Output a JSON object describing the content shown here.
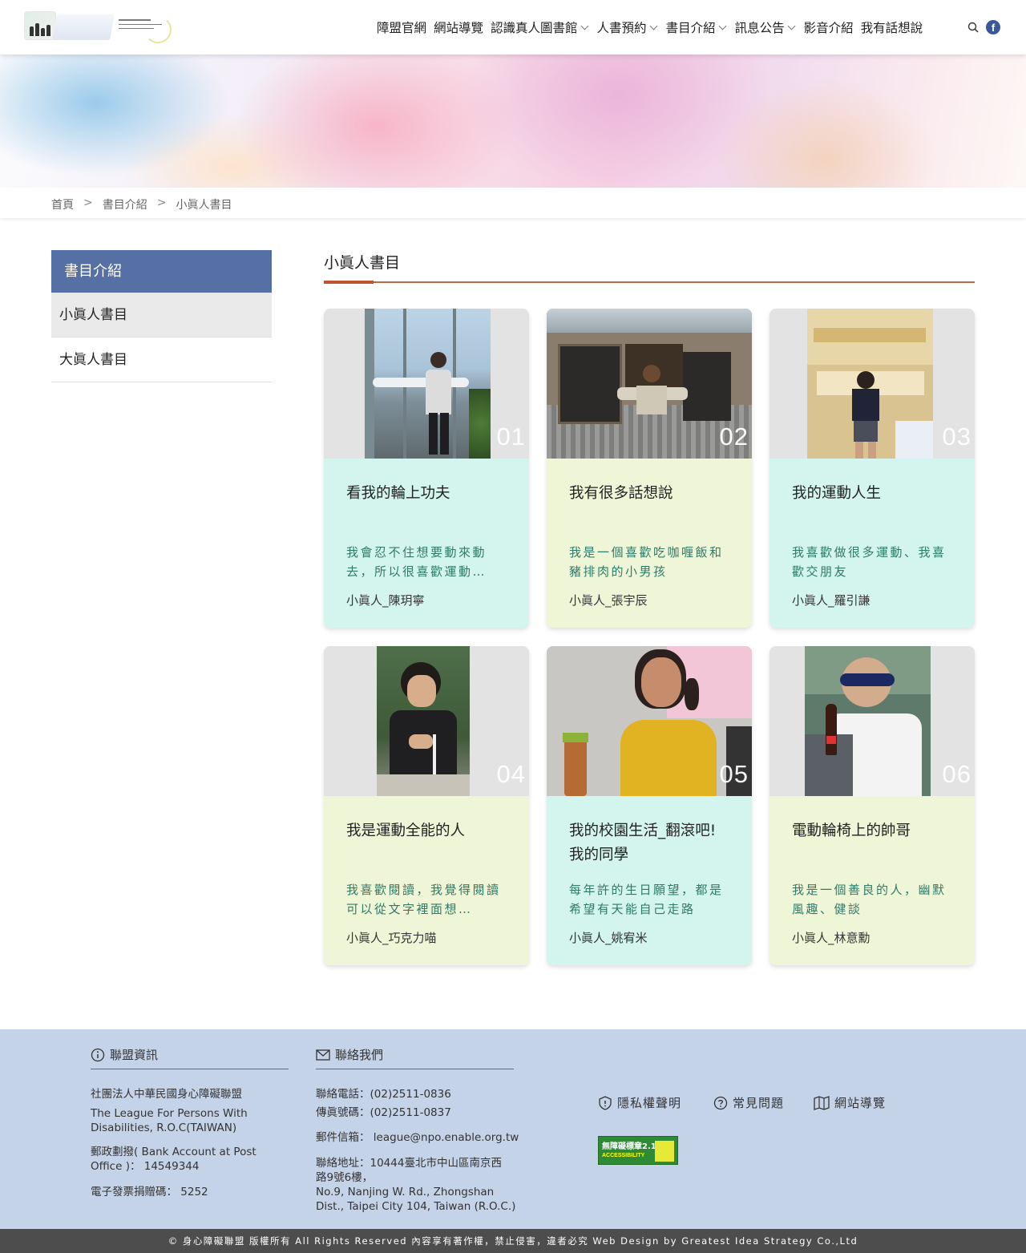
{
  "nav": {
    "items": [
      {
        "label": "障盟官網",
        "dropdown": false
      },
      {
        "label": "網站導覽",
        "dropdown": false
      },
      {
        "label": "認識真人圖書館",
        "dropdown": true
      },
      {
        "label": "人書預約",
        "dropdown": true
      },
      {
        "label": "書目介紹",
        "dropdown": true
      },
      {
        "label": "訊息公告",
        "dropdown": true
      },
      {
        "label": "影音介紹",
        "dropdown": false
      },
      {
        "label": "我有話想說",
        "dropdown": false
      }
    ],
    "facebook_glyph": "f"
  },
  "breadcrumb": {
    "home": "首頁",
    "section": "書目介紹",
    "current": "小眞人書目",
    "separator": ">"
  },
  "sidebar": {
    "title": "書目介紹",
    "items": [
      {
        "label": "小眞人書目",
        "active": true
      },
      {
        "label": "大眞人書目",
        "active": false
      }
    ]
  },
  "main": {
    "title": "小眞人書目",
    "accent_color": "#c0522e"
  },
  "cards": [
    {
      "num": "01",
      "title": "看我的輪上功夫",
      "desc": "我會忍不住想要動來動去，所以很喜歡運動…",
      "author": "小眞人_陳玥寧",
      "color": "cyan"
    },
    {
      "num": "02",
      "title": "我有很多話想說",
      "desc": "我是一個喜歡吃咖喱飯和豬排肉的小男孩",
      "author": "小眞人_張宇辰",
      "color": "lime"
    },
    {
      "num": "03",
      "title": "我的運動人生",
      "desc": "我喜歡做很多運動、我喜歡交朋友",
      "author": "小眞人_羅引謙",
      "color": "cyan"
    },
    {
      "num": "04",
      "title": "我是運動全能的人",
      "desc": "我喜歡閱讀，我覺得閱讀可以從文字裡面想…",
      "author": "小眞人_巧克力喵",
      "color": "lime"
    },
    {
      "num": "05",
      "title": "我的校園生活_翻滾吧! 我的同學",
      "desc": "每年許的生日願望，都是希望有天能自己走路",
      "author": "小眞人_姚宥米",
      "color": "cyan"
    },
    {
      "num": "06",
      "title": "電動輪椅上的帥哥",
      "desc": "我是一個善良的人，幽默風趣、健談",
      "author": "小眞人_林意勳",
      "color": "lime"
    }
  ],
  "footer": {
    "info_heading": "聯盟資訊",
    "contact_heading": "聯絡我們",
    "org_zh": "社團法人中華民國身心障礙聯盟",
    "org_en": "The League For Persons With Disabilities, R.O.C(TAIWAN)",
    "bank": "郵政劃撥( Bank Account at Post Office )： 14549344",
    "invoice": "電子發票捐贈碼： 5252",
    "phone": "聯絡電話：(02)2511-0836",
    "fax": "傳眞號碼：(02)2511-0837",
    "email": "郵件信箱： league@npo.enable.org.tw",
    "address_zh": "聯絡地址：10444臺北市中山區南京西路9號6樓，",
    "address_en": "No.9, Nanjing W. Rd., Zhongshan Dist., Taipei City 104, Taiwan (R.O.C.)",
    "links": [
      "隱私權聲明",
      "常見問題",
      "網站導覽"
    ],
    "badge_title": "無障礙標章2.1",
    "badge_sub": "ACCESSIBILITY"
  },
  "copyright": "© 身心障礙聯盟 版權所有 All Rights Reserved 內容享有著作權，禁止侵害，違者必究 Web Design by Greatest Idea Strategy Co.,Ltd"
}
